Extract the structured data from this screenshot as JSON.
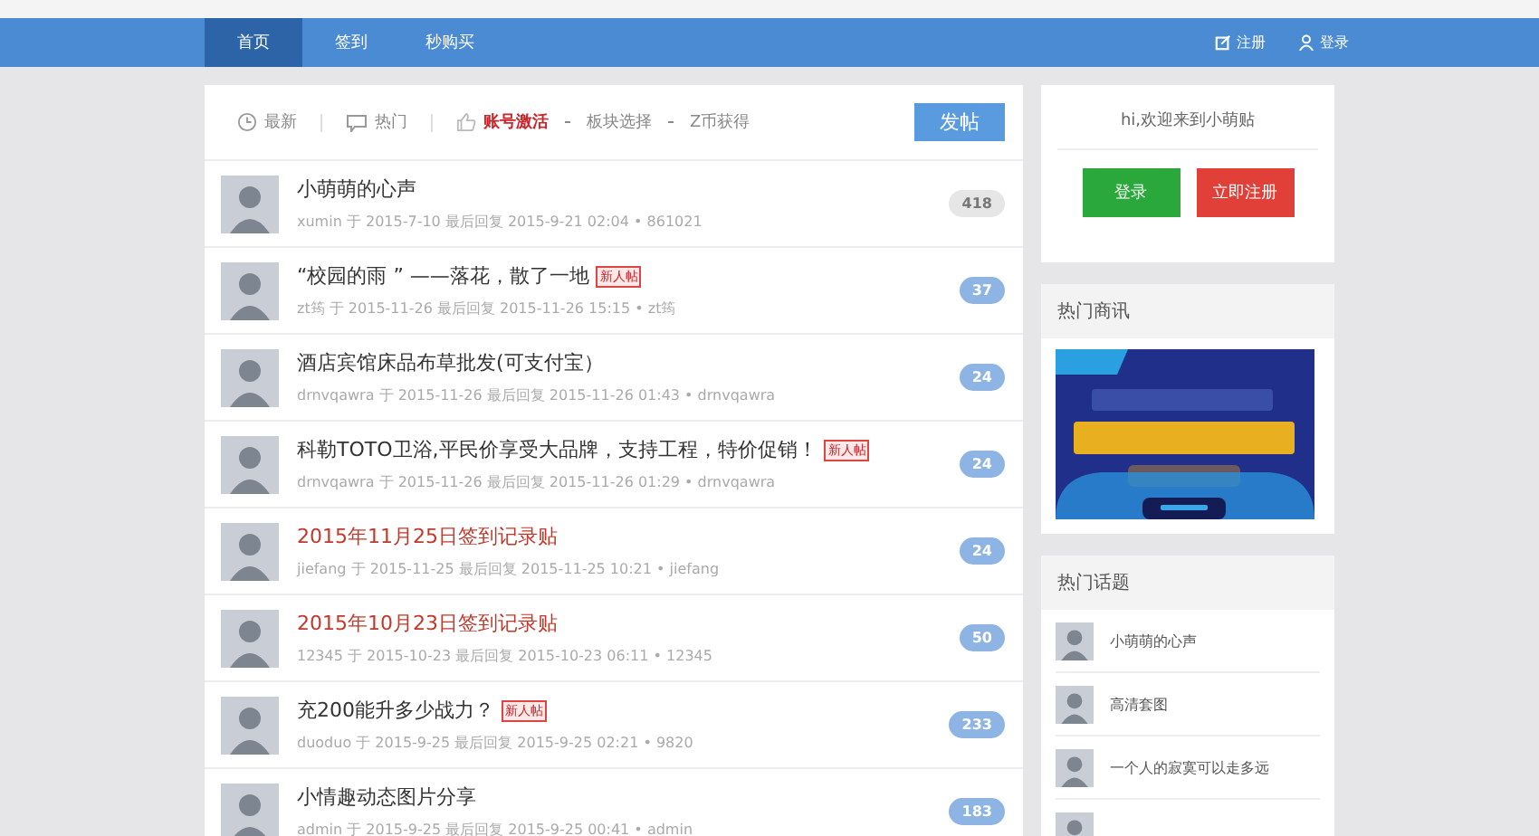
{
  "nav": {
    "items": [
      {
        "label": "首页",
        "selected": true
      },
      {
        "label": "签到",
        "selected": false
      },
      {
        "label": "秒购买",
        "selected": false
      }
    ],
    "account": [
      {
        "label": "注册",
        "kind": "edit"
      },
      {
        "label": "登录",
        "kind": "user"
      }
    ]
  },
  "filters": [
    {
      "label": "最新",
      "kind": "clock",
      "selected": false
    },
    {
      "label": "热门",
      "kind": "chat",
      "selected": false
    },
    {
      "label": "账号激活",
      "kind": "thumb",
      "selected": true
    },
    {
      "label": "板块选择",
      "kind": "plain",
      "selected": false
    },
    {
      "label": "Z币获得",
      "kind": "plain",
      "selected": false
    }
  ],
  "post_button": "发帖",
  "threads": [
    {
      "title": "小萌萌的心声",
      "highlighted": false,
      "meta": "xumin 于 2015-7-10 最后回复 2015-9-21 02:04 • 861021",
      "count": "418",
      "muted": true
    },
    {
      "title": "“校园的雨 ” ——落花，散了一地",
      "tag": "新人帖",
      "highlighted": false,
      "meta": "zt筠 于 2015-11-26 最后回复 2015-11-26 15:15 • zt筠",
      "count": "37",
      "muted": false
    },
    {
      "title": "酒店宾馆床品布草批发(可支付宝）",
      "highlighted": false,
      "meta": "drnvqawra 于 2015-11-26 最后回复 2015-11-26 01:43 • drnvqawra",
      "count": "24",
      "muted": false
    },
    {
      "title": "科勒TOTO卫浴,平民价享受大品牌，支持工程，特价促销！",
      "tag": "新人帖",
      "highlighted": false,
      "meta": "drnvqawra 于 2015-11-26 最后回复 2015-11-26 01:29 • drnvqawra",
      "count": "24",
      "muted": false
    },
    {
      "title": "2015年11月25日签到记录贴",
      "highlighted": true,
      "meta": "jiefang 于 2015-11-25 最后回复 2015-11-25 10:21 • jiefang",
      "count": "24",
      "muted": false
    },
    {
      "title": "2015年10月23日签到记录贴",
      "highlighted": true,
      "meta": "12345 于 2015-10-23 最后回复 2015-10-23 06:11 • 12345",
      "count": "50",
      "muted": false
    },
    {
      "title": "充200能升多少战力？",
      "tag": "新人帖",
      "highlighted": false,
      "meta": "duoduo 于 2015-9-25 最后回复 2015-9-25 02:21 • 9820",
      "count": "233",
      "muted": false
    },
    {
      "title": "小情趣动态图片分享",
      "highlighted": false,
      "meta": "admin 于 2015-9-25 最后回复 2015-9-25 00:41 • admin",
      "count": "183",
      "muted": false
    }
  ],
  "welcome": {
    "text": "hi,欢迎来到小萌贴",
    "buttons": [
      {
        "label": "登录",
        "kind": "login"
      },
      {
        "label": "立即注册",
        "kind": "register"
      }
    ]
  },
  "news": {
    "title": "热门商讯"
  },
  "topics": {
    "title": "热门话题",
    "items": [
      {
        "kind": "topic",
        "title": "小萌萌的心声"
      },
      {
        "kind": "topic",
        "title": "高清套图"
      },
      {
        "kind": "topic",
        "title": "一个人的寂寞可以走多远"
      },
      {
        "kind": "avatar"
      }
    ]
  }
}
